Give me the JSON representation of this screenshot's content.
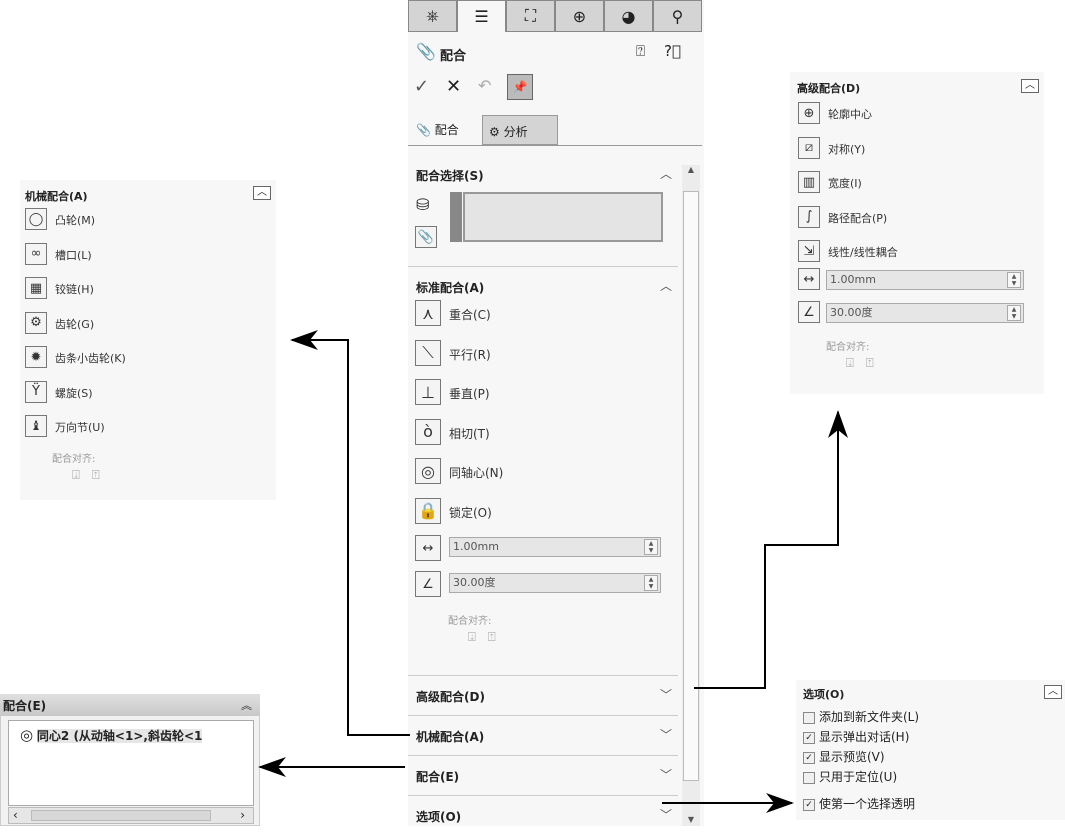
{
  "center": {
    "tabs": [
      {
        "icon": "feature-manager-icon",
        "glyph": "⎈"
      },
      {
        "icon": "property-manager-icon",
        "glyph": "☰"
      },
      {
        "icon": "configuration-manager-icon",
        "glyph": "⛶"
      },
      {
        "icon": "dimxpert-icon",
        "glyph": "⊕"
      },
      {
        "icon": "display-manager-icon",
        "glyph": "◕"
      },
      {
        "icon": "appearance-icon",
        "glyph": "⚲"
      }
    ],
    "title": "配合",
    "subtabs": [
      "配合",
      "分析"
    ],
    "sections": {
      "selection": "配合选择(S)",
      "standard": "标准配合(A)",
      "advanced": "高级配合(D)",
      "mechanical": "机械配合(A)",
      "mates": "配合(E)",
      "options": "选项(O)"
    },
    "standard_items": [
      {
        "label": "重合(C)",
        "icon": "coincident-icon",
        "glyph": "⋏"
      },
      {
        "label": "平行(R)",
        "icon": "parallel-icon",
        "glyph": "⟍"
      },
      {
        "label": "垂直(P)",
        "icon": "perpendicular-icon",
        "glyph": "⊥"
      },
      {
        "label": "相切(T)",
        "icon": "tangent-icon",
        "glyph": "ò"
      },
      {
        "label": "同轴心(N)",
        "icon": "concentric-icon",
        "glyph": "◎"
      },
      {
        "label": "锁定(O)",
        "icon": "lock-icon",
        "glyph": "🔒"
      }
    ],
    "distance": "1.00mm",
    "angle": "30.00度",
    "align_label": "配合对齐:"
  },
  "mechanical": {
    "title": "机械配合(A)",
    "items": [
      {
        "label": "凸轮(M)",
        "icon": "cam-icon",
        "glyph": "◯"
      },
      {
        "label": "槽口(L)",
        "icon": "slot-icon",
        "glyph": "∞"
      },
      {
        "label": "铰链(H)",
        "icon": "hinge-icon",
        "glyph": "▦"
      },
      {
        "label": "齿轮(G)",
        "icon": "gear-icon",
        "glyph": "⚙"
      },
      {
        "label": "齿条小齿轮(K)",
        "icon": "rack-pinion-icon",
        "glyph": "✹"
      },
      {
        "label": "螺旋(S)",
        "icon": "screw-icon",
        "glyph": "Ÿ"
      },
      {
        "label": "万向节(U)",
        "icon": "universal-joint-icon",
        "glyph": "♝"
      }
    ],
    "align_label": "配合对齐:"
  },
  "advanced": {
    "title": "高级配合(D)",
    "items": [
      {
        "label": "轮廓中心",
        "icon": "profile-center-icon",
        "glyph": "⊕"
      },
      {
        "label": "对称(Y)",
        "icon": "symmetric-icon",
        "glyph": "⧄"
      },
      {
        "label": "宽度(I)",
        "icon": "width-icon",
        "glyph": "▥"
      },
      {
        "label": "路径配合(P)",
        "icon": "path-mate-icon",
        "glyph": "∫"
      },
      {
        "label": "线性/线性耦合",
        "icon": "linear-coupler-icon",
        "glyph": "⇲"
      }
    ],
    "distance": "1.00mm",
    "angle": "30.00度",
    "align_label": "配合对齐:"
  },
  "mates": {
    "title": "配合(E)",
    "entry": "同心2 (从动轴<1>,斜齿轮<1"
  },
  "options": {
    "title": "选项(O)",
    "items": [
      {
        "label": "添加到新文件夹(L)",
        "checked": false
      },
      {
        "label": "显示弹出对话(H)",
        "checked": true
      },
      {
        "label": "显示预览(V)",
        "checked": true
      },
      {
        "label": "只用于定位(U)",
        "checked": false
      },
      {
        "label": "使第一个选择透明",
        "checked": true
      }
    ]
  }
}
